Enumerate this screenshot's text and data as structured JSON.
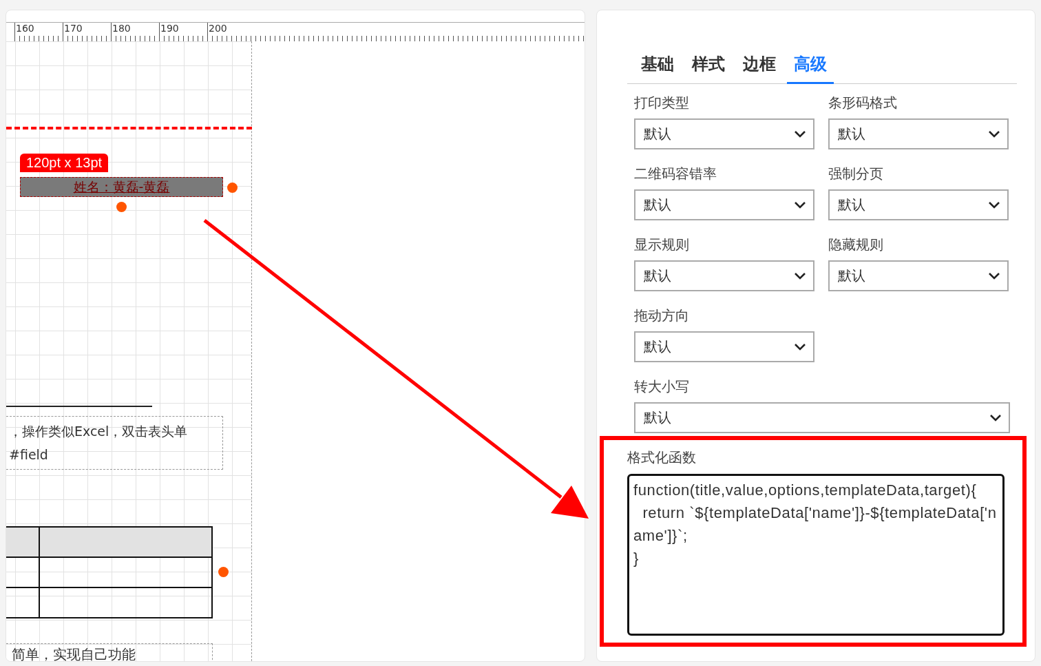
{
  "canvas": {
    "ruler": [
      "160",
      "170",
      "180",
      "190",
      "200"
    ],
    "selected_element": {
      "size": "120pt x 13pt",
      "text": "姓名：黄磊-黄磊",
      "selected": true
    },
    "text_box": {
      "lines": [
        "，操作类似Excel，双击表头单",
        "#field"
      ]
    },
    "bottom_text": "简单，实现自己功能"
  },
  "panel": {
    "tabs": [
      {
        "label": "基础",
        "selected": false
      },
      {
        "label": "样式",
        "selected": false
      },
      {
        "label": "边框",
        "selected": false
      },
      {
        "label": "高级",
        "selected": true
      }
    ],
    "rows": [
      [
        {
          "label": "打印类型",
          "value": "默认"
        },
        {
          "label": "条形码格式",
          "value": "默认"
        }
      ],
      [
        {
          "label": "二维码容错率",
          "value": "默认"
        },
        {
          "label": "强制分页",
          "value": "默认"
        }
      ],
      [
        {
          "label": "显示规则",
          "value": "默认"
        },
        {
          "label": "隐藏规则",
          "value": "默认"
        }
      ],
      [
        {
          "label": "拖动方向",
          "value": "默认"
        }
      ],
      [
        {
          "label": "转大小写",
          "value": "默认"
        }
      ]
    ],
    "format_function": {
      "label": "格式化函数",
      "value": "function(title,value,options,templateData,target){\n  return `${templateData['name']}-${templateData['name']}`;\n}",
      "highlighted": true
    }
  }
}
